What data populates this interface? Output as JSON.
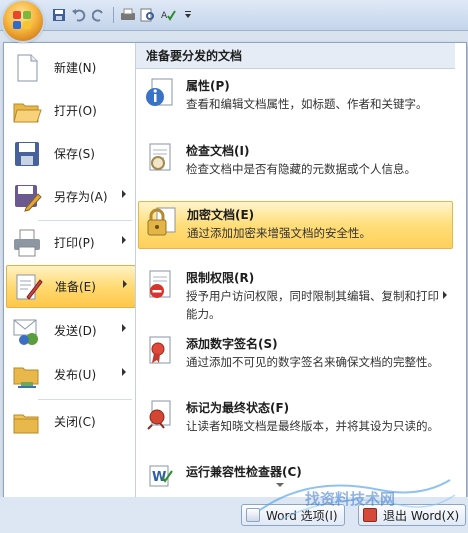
{
  "quick_access": {
    "icons": [
      "save-icon",
      "undo-icon",
      "redo-icon",
      "print-icon",
      "print-preview-icon",
      "spellcheck-icon",
      "customize-icon"
    ]
  },
  "left_menu": {
    "items": [
      {
        "label": "新建(N)",
        "icon": "new-document-icon"
      },
      {
        "label": "打开(O)",
        "icon": "open-folder-icon"
      },
      {
        "label": "保存(S)",
        "icon": "save-disk-icon"
      },
      {
        "label": "另存为(A)",
        "icon": "save-as-icon",
        "submenu": true
      },
      {
        "label": "打印(P)",
        "icon": "printer-icon",
        "submenu": true
      },
      {
        "label": "准备(E)",
        "icon": "prepare-icon",
        "submenu": true,
        "active": true
      },
      {
        "label": "发送(D)",
        "icon": "send-icon",
        "submenu": true
      },
      {
        "label": "发布(U)",
        "icon": "publish-icon",
        "submenu": true
      },
      {
        "label": "关闭(C)",
        "icon": "close-folder-icon"
      }
    ]
  },
  "right_panel": {
    "header": "准备要分发的文档",
    "items": [
      {
        "title": "属性(P)",
        "desc": "查看和编辑文档属性，如标题、作者和关键字。",
        "icon": "properties-icon"
      },
      {
        "title": "检查文档(I)",
        "desc": "检查文档中是否有隐藏的元数据或个人信息。",
        "icon": "inspect-document-icon"
      },
      {
        "title": "加密文档(E)",
        "desc": "通过添加加密来增强文档的安全性。",
        "icon": "encrypt-lock-icon",
        "active": true
      },
      {
        "title": "限制权限(R)",
        "desc": "授予用户访问权限，同时限制其编辑、复制和打印能力。",
        "icon": "restrict-permission-icon",
        "submenu": true
      },
      {
        "title": "添加数字签名(S)",
        "desc": "通过添加不可见的数字签名来确保文档的完整性。",
        "icon": "digital-signature-icon"
      },
      {
        "title": "标记为最终状态(F)",
        "desc": "让读者知晓文档是最终版本，并将其设为只读的。",
        "icon": "mark-final-icon"
      },
      {
        "title": "运行兼容性检查器(C)",
        "desc": "",
        "icon": "compatibility-checker-icon"
      }
    ]
  },
  "bottom": {
    "options_button": "Word 选项(I)",
    "exit_button": "退出 Word(X)"
  },
  "watermark": {
    "text": "找资料技术网"
  },
  "colors": {
    "highlight": "#ffd86d",
    "frame": "#8ea4c3",
    "header_bg": "#e5ecf5"
  }
}
